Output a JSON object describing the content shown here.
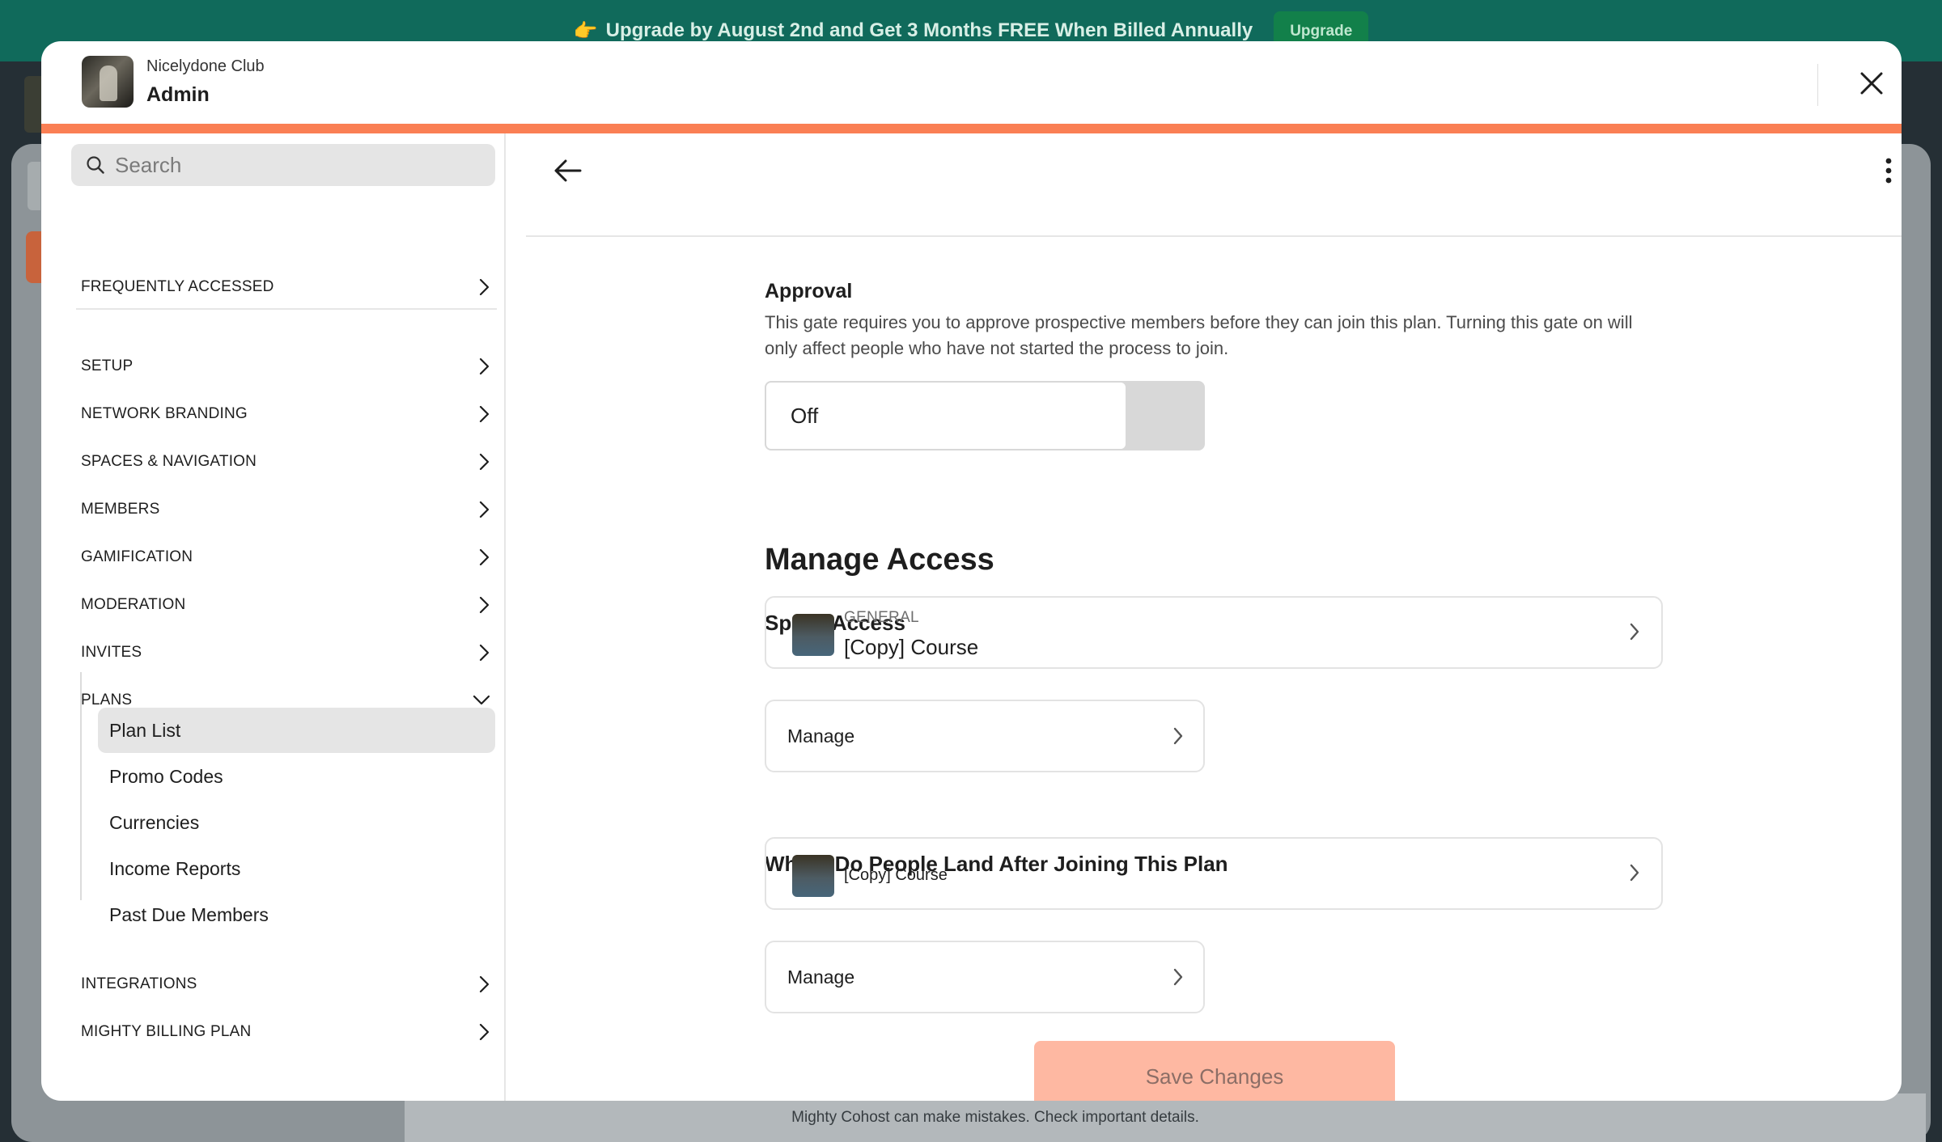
{
  "banner": {
    "text": "Upgrade by August 2nd and Get 3 Months FREE When Billed Annually",
    "button_label": "Upgrade",
    "hand_glyph": "👉"
  },
  "background": {
    "footer_text": "Mighty Cohost can make mistakes. Check important details."
  },
  "modal": {
    "club_name": "Nicelydone Club",
    "title": "Admin",
    "accent_color": "#fa7f54"
  },
  "sidebar": {
    "search_placeholder": "Search",
    "frequently_accessed": "FREQUENTLY ACCESSED",
    "items": [
      {
        "label": "SETUP"
      },
      {
        "label": "NETWORK BRANDING"
      },
      {
        "label": "SPACES & NAVIGATION"
      },
      {
        "label": "MEMBERS"
      },
      {
        "label": "GAMIFICATION"
      },
      {
        "label": "MODERATION"
      },
      {
        "label": "INVITES"
      },
      {
        "label": "PLANS",
        "expanded": true
      }
    ],
    "plans_sub": [
      {
        "label": "Plan List",
        "active": true
      },
      {
        "label": "Promo Codes"
      },
      {
        "label": "Currencies"
      },
      {
        "label": "Income Reports"
      },
      {
        "label": "Past Due Members"
      }
    ],
    "bottom_items": [
      {
        "label": "INTEGRATIONS"
      },
      {
        "label": "MIGHTY BILLING PLAN"
      }
    ]
  },
  "main": {
    "approval": {
      "title": "Approval",
      "description": "This gate requires you to approve prospective members before they can join this plan. Turning this gate on will only affect people who have not started the process to join.",
      "toggle_value": "Off"
    },
    "manage_access_title": "Manage Access",
    "space_access": {
      "title": "Space Access",
      "card_label": "GENERAL",
      "card_value": "[Copy] Course",
      "manage_label": "Manage"
    },
    "landing": {
      "title": "Where Do People Land After Joining This Plan",
      "card_value": "[Copy] Course",
      "manage_label": "Manage"
    },
    "save_label": "Save Changes",
    "save_color": "#feb8a2"
  }
}
